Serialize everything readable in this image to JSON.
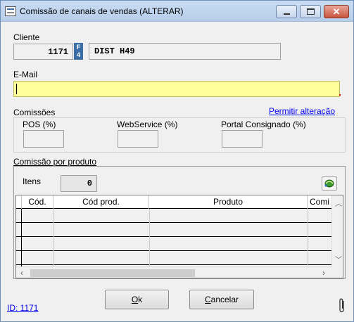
{
  "window": {
    "title": "Comissão de canais de vendas (ALTERAR)"
  },
  "cliente": {
    "label": "Cliente",
    "code": "1171",
    "lookup_key": "F4",
    "name": "DIST H49"
  },
  "email": {
    "label": "E-Mail",
    "value": ""
  },
  "comissoes": {
    "label": "Comissões",
    "permitir_link": "Permitir alteração",
    "fields": [
      {
        "label": "POS (%)",
        "value": ""
      },
      {
        "label": "WebService (%)",
        "value": ""
      },
      {
        "label": "Portal Consignado (%)",
        "value": ""
      }
    ]
  },
  "produto": {
    "label": "Comissão por produto",
    "itens_label": "Itens",
    "itens_count": "0",
    "columns": [
      "Cód.",
      "Cód prod.",
      "Produto",
      "Comi"
    ]
  },
  "buttons": {
    "ok_underlined": "O",
    "ok_rest": "k",
    "cancel_underlined": "C",
    "cancel_rest": "ancelar"
  },
  "footer": {
    "id_link": "ID: 1171"
  },
  "icons": {
    "app": "app-icon",
    "refresh": "refresh-icon",
    "attachment": "paperclip-icon"
  },
  "colors": {
    "email_bg": "#ffff99",
    "f4_bg": "#3a6ea5",
    "link": "#0000ee"
  }
}
